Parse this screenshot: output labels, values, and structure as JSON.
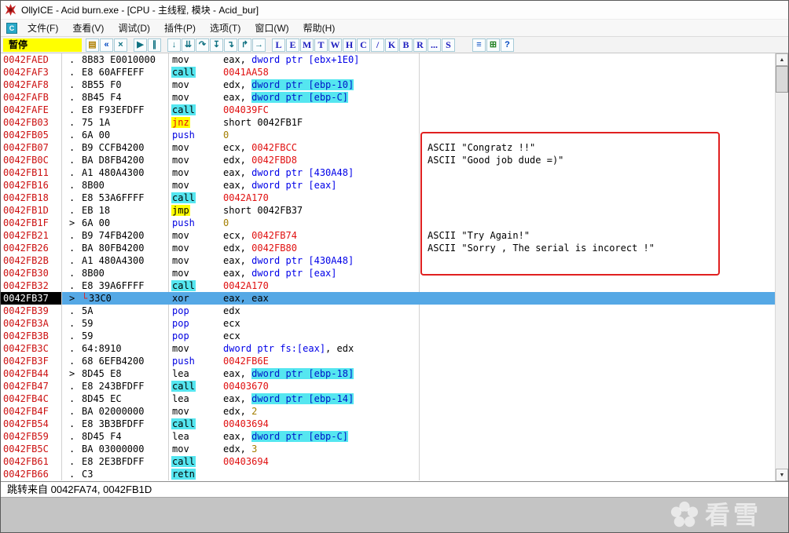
{
  "window": {
    "title": "OllyICE - Acid burn.exe - [CPU - 主线程, 模块 - Acid_bur]"
  },
  "menu": {
    "items": [
      {
        "id": "file",
        "label": "文件(F)"
      },
      {
        "id": "view",
        "label": "查看(V)"
      },
      {
        "id": "debug",
        "label": "调试(D)"
      },
      {
        "id": "plugins",
        "label": "插件(P)"
      },
      {
        "id": "options",
        "label": "选项(T)"
      },
      {
        "id": "window",
        "label": "窗口(W)"
      },
      {
        "id": "help",
        "label": "帮助(H)"
      }
    ]
  },
  "toolbar": {
    "status_label": "暂停",
    "groups": [
      {
        "buttons": [
          {
            "name": "open-file-button",
            "icon": "open-folder-icon",
            "glyph": "▤",
            "color": "#B08000"
          },
          {
            "name": "restart-button",
            "icon": "restart-icon",
            "glyph": "«",
            "color": "#0048C0"
          },
          {
            "name": "close-program-button",
            "icon": "close-icon",
            "glyph": "×",
            "color": "#0E7080"
          }
        ]
      },
      {
        "buttons": [
          {
            "name": "run-button",
            "icon": "play-icon",
            "glyph": "▶",
            "color": "#0E7080"
          },
          {
            "name": "pause-button",
            "icon": "pause-icon",
            "glyph": "∥",
            "color": "#0E7080"
          }
        ]
      },
      {
        "buttons": [
          {
            "name": "step-into-button",
            "icon": "step-into-icon",
            "glyph": "↓",
            "color": "#0E7080"
          },
          {
            "name": "animate-into-button",
            "icon": "animate-into-icon",
            "glyph": "⇊",
            "color": "#0E7080"
          },
          {
            "name": "step-over-button",
            "icon": "step-over-icon",
            "glyph": "↷",
            "color": "#0E7080"
          },
          {
            "name": "trace-into-button",
            "icon": "trace-into-icon",
            "glyph": "↧",
            "color": "#0E7080"
          },
          {
            "name": "trace-over-button",
            "icon": "trace-over-icon",
            "glyph": "↴",
            "color": "#0E7080"
          },
          {
            "name": "execute-till-return-button",
            "icon": "return-icon",
            "glyph": "↱",
            "color": "#0E7080"
          },
          {
            "name": "go-to-button",
            "icon": "goto-icon",
            "glyph": "→",
            "color": "#0E7080"
          }
        ]
      },
      {
        "buttons": [
          {
            "name": "log-window-button",
            "icon": "letter-L-icon",
            "glyph": "L",
            "color": "#2020C0",
            "cls": "letter"
          },
          {
            "name": "executables-window-button",
            "icon": "letter-E-icon",
            "glyph": "E",
            "color": "#2020C0",
            "cls": "letter"
          },
          {
            "name": "memory-window-button",
            "icon": "letter-M-icon",
            "glyph": "M",
            "color": "#2020C0",
            "cls": "letter"
          },
          {
            "name": "threads-window-button",
            "icon": "letter-T-icon",
            "glyph": "T",
            "color": "#2020C0",
            "cls": "letter"
          },
          {
            "name": "windows-window-button",
            "icon": "letter-W-icon",
            "glyph": "W",
            "color": "#2020C0",
            "cls": "letter"
          },
          {
            "name": "handles-window-button",
            "icon": "letter-H-icon",
            "glyph": "H",
            "color": "#2020C0",
            "cls": "letter"
          },
          {
            "name": "cpu-window-button",
            "icon": "letter-C-icon",
            "glyph": "C",
            "color": "#2020C0",
            "cls": "letter"
          },
          {
            "name": "patches-window-button",
            "icon": "slash-icon",
            "glyph": "/",
            "color": "#2020C0",
            "cls": "letter"
          },
          {
            "name": "call-stack-window-button",
            "icon": "letter-K-icon",
            "glyph": "K",
            "color": "#2020C0",
            "cls": "letter"
          },
          {
            "name": "breakpoints-window-button",
            "icon": "letter-B-icon",
            "glyph": "B",
            "color": "#2020C0",
            "cls": "letter"
          },
          {
            "name": "references-window-button",
            "icon": "letter-R-icon",
            "glyph": "R",
            "color": "#2020C0",
            "cls": "letter"
          },
          {
            "name": "run-trace-window-button",
            "icon": "ellipsis-icon",
            "glyph": "...",
            "color": "#2020C0",
            "cls": "letter"
          },
          {
            "name": "source-window-button",
            "icon": "letter-S-icon",
            "glyph": "S",
            "color": "#2020C0",
            "cls": "letter"
          }
        ]
      },
      {
        "buttons": [
          {
            "name": "options-button",
            "icon": "options-list-icon",
            "glyph": "≡",
            "color": "#0048C0"
          },
          {
            "name": "appearance-button",
            "icon": "windows-grid-icon",
            "glyph": "⊞",
            "color": "#208020"
          },
          {
            "name": "help-button",
            "icon": "help-icon",
            "glyph": "?",
            "color": "#0048C0"
          }
        ]
      }
    ]
  },
  "disasm": {
    "selected_address": "0042FB37",
    "rows": [
      {
        "addr": "0042FAED",
        "flag": ".",
        "hex": "8B83 E0010000",
        "mn": "mov",
        "ms": "plain",
        "ops": [
          [
            "eax, ",
            "plain"
          ],
          [
            "dword ptr [ebx+1E0]",
            "mem"
          ]
        ],
        "cmt": ""
      },
      {
        "addr": "0042FAF3",
        "flag": ".",
        "hex": "E8 60AFFEFF",
        "mn": "call",
        "ms": "call",
        "ops": [
          [
            "0041AA58",
            "addr"
          ]
        ],
        "cmt": ""
      },
      {
        "addr": "0042FAF8",
        "flag": ".",
        "hex": "8B55 F0",
        "mn": "mov",
        "ms": "plain",
        "ops": [
          [
            "edx, ",
            "plain"
          ],
          [
            "dword ptr [ebp-10]",
            "stack"
          ]
        ],
        "cmt": ""
      },
      {
        "addr": "0042FAFB",
        "flag": ".",
        "hex": "8B45 F4",
        "mn": "mov",
        "ms": "plain",
        "ops": [
          [
            "eax, ",
            "plain"
          ],
          [
            "dword ptr [ebp-C]",
            "stack"
          ]
        ],
        "cmt": ""
      },
      {
        "addr": "0042FAFE",
        "flag": ".",
        "hex": "E8 F93EFDFF",
        "mn": "call",
        "ms": "call",
        "ops": [
          [
            "004039FC",
            "addr"
          ]
        ],
        "cmt": ""
      },
      {
        "addr": "0042FB03",
        "flag": ".",
        "hex": "75 1A",
        "mn": "jnz",
        "ms": "jcc",
        "ops": [
          [
            "short 0042FB1F",
            "plain"
          ]
        ],
        "cmt": ""
      },
      {
        "addr": "0042FB05",
        "flag": ".",
        "hex": "6A 00",
        "mn": "push",
        "ms": "push",
        "ops": [
          [
            "0",
            "const"
          ]
        ],
        "cmt": ""
      },
      {
        "addr": "0042FB07",
        "flag": ".",
        "hex": "B9 CCFB4200",
        "mn": "mov",
        "ms": "plain",
        "ops": [
          [
            "ecx, ",
            "plain"
          ],
          [
            "0042FBCC",
            "addr"
          ]
        ],
        "cmt": "ASCII \"Congratz !!\""
      },
      {
        "addr": "0042FB0C",
        "flag": ".",
        "hex": "BA D8FB4200",
        "mn": "mov",
        "ms": "plain",
        "ops": [
          [
            "edx, ",
            "plain"
          ],
          [
            "0042FBD8",
            "addr"
          ]
        ],
        "cmt": "ASCII \"Good job dude =)\""
      },
      {
        "addr": "0042FB11",
        "flag": ".",
        "hex": "A1 480A4300",
        "mn": "mov",
        "ms": "plain",
        "ops": [
          [
            "eax, ",
            "plain"
          ],
          [
            "dword ptr [430A48]",
            "mem"
          ]
        ],
        "cmt": ""
      },
      {
        "addr": "0042FB16",
        "flag": ".",
        "hex": "8B00",
        "mn": "mov",
        "ms": "plain",
        "ops": [
          [
            "eax, ",
            "plain"
          ],
          [
            "dword ptr [eax]",
            "mem"
          ]
        ],
        "cmt": ""
      },
      {
        "addr": "0042FB18",
        "flag": ".",
        "hex": "E8 53A6FFFF",
        "mn": "call",
        "ms": "call",
        "ops": [
          [
            "0042A170",
            "addr"
          ]
        ],
        "cmt": ""
      },
      {
        "addr": "0042FB1D",
        "flag": ".",
        "hex": "EB 18",
        "mn": "jmp",
        "ms": "jmp",
        "ops": [
          [
            "short 0042FB37",
            "plain"
          ]
        ],
        "cmt": ""
      },
      {
        "addr": "0042FB1F",
        "flag": ">",
        "hex": "6A 00",
        "mn": "push",
        "ms": "push",
        "ops": [
          [
            "0",
            "const"
          ]
        ],
        "cmt": ""
      },
      {
        "addr": "0042FB21",
        "flag": ".",
        "hex": "B9 74FB4200",
        "mn": "mov",
        "ms": "plain",
        "ops": [
          [
            "ecx, ",
            "plain"
          ],
          [
            "0042FB74",
            "addr"
          ]
        ],
        "cmt": "ASCII \"Try Again!\""
      },
      {
        "addr": "0042FB26",
        "flag": ".",
        "hex": "BA 80FB4200",
        "mn": "mov",
        "ms": "plain",
        "ops": [
          [
            "edx, ",
            "plain"
          ],
          [
            "0042FB80",
            "addr"
          ]
        ],
        "cmt": "ASCII \"Sorry , The serial is incorect !\""
      },
      {
        "addr": "0042FB2B",
        "flag": ".",
        "hex": "A1 480A4300",
        "mn": "mov",
        "ms": "plain",
        "ops": [
          [
            "eax, ",
            "plain"
          ],
          [
            "dword ptr [430A48]",
            "mem"
          ]
        ],
        "cmt": ""
      },
      {
        "addr": "0042FB30",
        "flag": ".",
        "hex": "8B00",
        "mn": "mov",
        "ms": "plain",
        "ops": [
          [
            "eax, ",
            "plain"
          ],
          [
            "dword ptr [eax]",
            "mem"
          ]
        ],
        "cmt": ""
      },
      {
        "addr": "0042FB32",
        "flag": ".",
        "hex": "E8 39A6FFFF",
        "mn": "call",
        "ms": "call",
        "ops": [
          [
            "0042A170",
            "addr"
          ]
        ],
        "cmt": ""
      },
      {
        "addr": "0042FB37",
        "flag": ">",
        "hex": "33C0",
        "mn": "xor",
        "ms": "plain",
        "ops": [
          [
            "eax, eax",
            "plain"
          ]
        ],
        "cmt": "",
        "sel": true,
        "mark": true
      },
      {
        "addr": "0042FB39",
        "flag": ".",
        "hex": "5A",
        "mn": "pop",
        "ms": "push",
        "ops": [
          [
            "edx",
            "plain"
          ]
        ],
        "cmt": ""
      },
      {
        "addr": "0042FB3A",
        "flag": ".",
        "hex": "59",
        "mn": "pop",
        "ms": "push",
        "ops": [
          [
            "ecx",
            "plain"
          ]
        ],
        "cmt": ""
      },
      {
        "addr": "0042FB3B",
        "flag": ".",
        "hex": "59",
        "mn": "pop",
        "ms": "push",
        "ops": [
          [
            "ecx",
            "plain"
          ]
        ],
        "cmt": ""
      },
      {
        "addr": "0042FB3C",
        "flag": ".",
        "hex": "64:8910",
        "mn": "mov",
        "ms": "plain",
        "ops": [
          [
            "dword ptr fs:[eax]",
            "mem"
          ],
          [
            ", edx",
            "plain"
          ]
        ],
        "cmt": ""
      },
      {
        "addr": "0042FB3F",
        "flag": ".",
        "hex": "68 6EFB4200",
        "mn": "push",
        "ms": "push",
        "ops": [
          [
            "0042FB6E",
            "addr"
          ]
        ],
        "cmt": ""
      },
      {
        "addr": "0042FB44",
        "flag": ">",
        "hex": "8D45 E8",
        "mn": "lea",
        "ms": "plain",
        "ops": [
          [
            "eax, ",
            "plain"
          ],
          [
            "dword ptr [ebp-18]",
            "stack"
          ]
        ],
        "cmt": ""
      },
      {
        "addr": "0042FB47",
        "flag": ".",
        "hex": "E8 243BFDFF",
        "mn": "call",
        "ms": "call",
        "ops": [
          [
            "00403670",
            "addr"
          ]
        ],
        "cmt": ""
      },
      {
        "addr": "0042FB4C",
        "flag": ".",
        "hex": "8D45 EC",
        "mn": "lea",
        "ms": "plain",
        "ops": [
          [
            "eax, ",
            "plain"
          ],
          [
            "dword ptr [ebp-14]",
            "stack"
          ]
        ],
        "cmt": ""
      },
      {
        "addr": "0042FB4F",
        "flag": ".",
        "hex": "BA 02000000",
        "mn": "mov",
        "ms": "plain",
        "ops": [
          [
            "edx, ",
            "plain"
          ],
          [
            "2",
            "const"
          ]
        ],
        "cmt": ""
      },
      {
        "addr": "0042FB54",
        "flag": ".",
        "hex": "E8 3B3BFDFF",
        "mn": "call",
        "ms": "call",
        "ops": [
          [
            "00403694",
            "addr"
          ]
        ],
        "cmt": ""
      },
      {
        "addr": "0042FB59",
        "flag": ".",
        "hex": "8D45 F4",
        "mn": "lea",
        "ms": "plain",
        "ops": [
          [
            "eax, ",
            "plain"
          ],
          [
            "dword ptr [ebp-C]",
            "stack"
          ]
        ],
        "cmt": ""
      },
      {
        "addr": "0042FB5C",
        "flag": ".",
        "hex": "BA 03000000",
        "mn": "mov",
        "ms": "plain",
        "ops": [
          [
            "edx, ",
            "plain"
          ],
          [
            "3",
            "const"
          ]
        ],
        "cmt": ""
      },
      {
        "addr": "0042FB61",
        "flag": ".",
        "hex": "E8 2E3BFDFF",
        "mn": "call",
        "ms": "call",
        "ops": [
          [
            "00403694",
            "addr"
          ]
        ],
        "cmt": ""
      },
      {
        "addr": "0042FB66",
        "flag": ".",
        "hex": "C3",
        "mn": "retn",
        "ms": "call",
        "ops": [],
        "cmt": ""
      }
    ]
  },
  "info_pane": {
    "text": "跳转来自 0042FA74, 0042FB1D"
  },
  "watermark": {
    "text": "看雪"
  },
  "colors": {
    "statusBg": "#FFFF00",
    "addr": "#CC1111",
    "callBg": "#55E6F0",
    "hlYellow": "#FFFF00",
    "selBg": "#55A8E5",
    "annotation": "#E02020",
    "memBlue": "#0000E8",
    "constGold": "#A37E00"
  }
}
